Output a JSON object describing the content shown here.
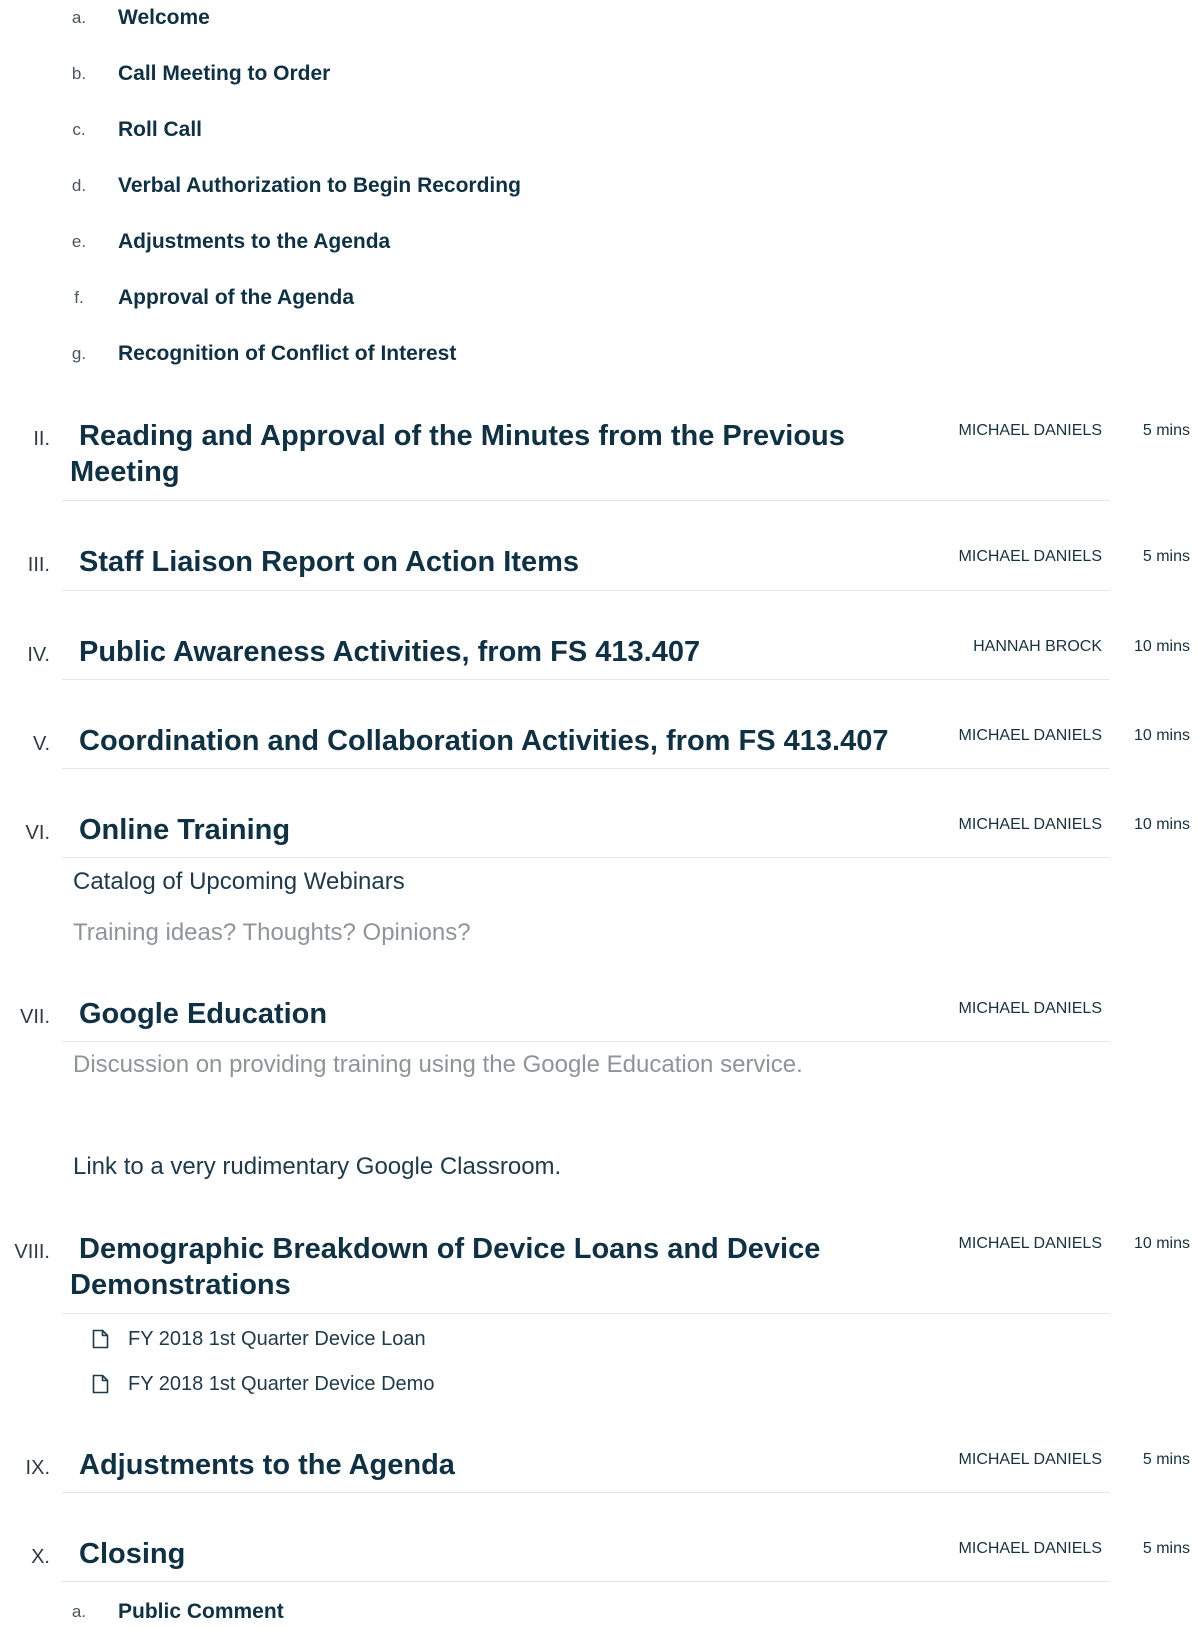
{
  "top_subitems": [
    {
      "letter": "a.",
      "label": "Welcome"
    },
    {
      "letter": "b.",
      "label": "Call Meeting to Order"
    },
    {
      "letter": "c.",
      "label": "Roll Call"
    },
    {
      "letter": "d.",
      "label": "Verbal Authorization to Begin Recording"
    },
    {
      "letter": "e.",
      "label": "Adjustments to the Agenda"
    },
    {
      "letter": "f.",
      "label": "Approval of the Agenda"
    },
    {
      "letter": "g.",
      "label": "Recognition of Conflict of Interest"
    }
  ],
  "items": [
    {
      "numeral": "II.",
      "title": "Reading and Approval of the Minutes from the Previous Meeting",
      "presenter": "MICHAEL DANIELS",
      "duration": "5 mins"
    },
    {
      "numeral": "III.",
      "title": "Staff Liaison Report on Action Items",
      "presenter": "MICHAEL DANIELS",
      "duration": "5 mins"
    },
    {
      "numeral": "IV.",
      "title": "Public Awareness Activities, from FS 413.407",
      "presenter": "HANNAH BROCK",
      "duration": "10 mins"
    },
    {
      "numeral": "V.",
      "title": "Coordination and Collaboration Activities, from FS 413.407",
      "presenter": "MICHAEL DANIELS",
      "duration": "10 mins"
    },
    {
      "numeral": "VI.",
      "title": "Online Training",
      "presenter": "MICHAEL DANIELS",
      "duration": "10 mins",
      "link": "Catalog of Upcoming Webinars",
      "note": "Training ideas? Thoughts? Opinions?"
    },
    {
      "numeral": "VII.",
      "title": "Google Education",
      "presenter": "MICHAEL DANIELS",
      "description": "Discussion on providing training using the Google Education service.",
      "link": "Link to a very rudimentary Google Classroom."
    },
    {
      "numeral": "VIII.",
      "title": "Demographic Breakdown of Device Loans and Device Demonstrations",
      "presenter": "MICHAEL DANIELS",
      "duration": "10 mins",
      "attachments": [
        "FY 2018 1st Quarter Device Loan",
        "FY 2018 1st Quarter Device Demo"
      ]
    },
    {
      "numeral": "IX.",
      "title": "Adjustments to the Agenda",
      "presenter": "MICHAEL DANIELS",
      "duration": "5 mins"
    },
    {
      "numeral": "X.",
      "title": "Closing",
      "presenter": "MICHAEL DANIELS",
      "duration": "5 mins"
    }
  ],
  "closing_subitems": [
    {
      "letter": "a.",
      "label": "Public Comment"
    }
  ],
  "icons": {
    "attachment": "file-icon"
  },
  "colors": {
    "heading": "#0f3144",
    "muted": "#8e9599",
    "divider": "#e3e6e8"
  }
}
